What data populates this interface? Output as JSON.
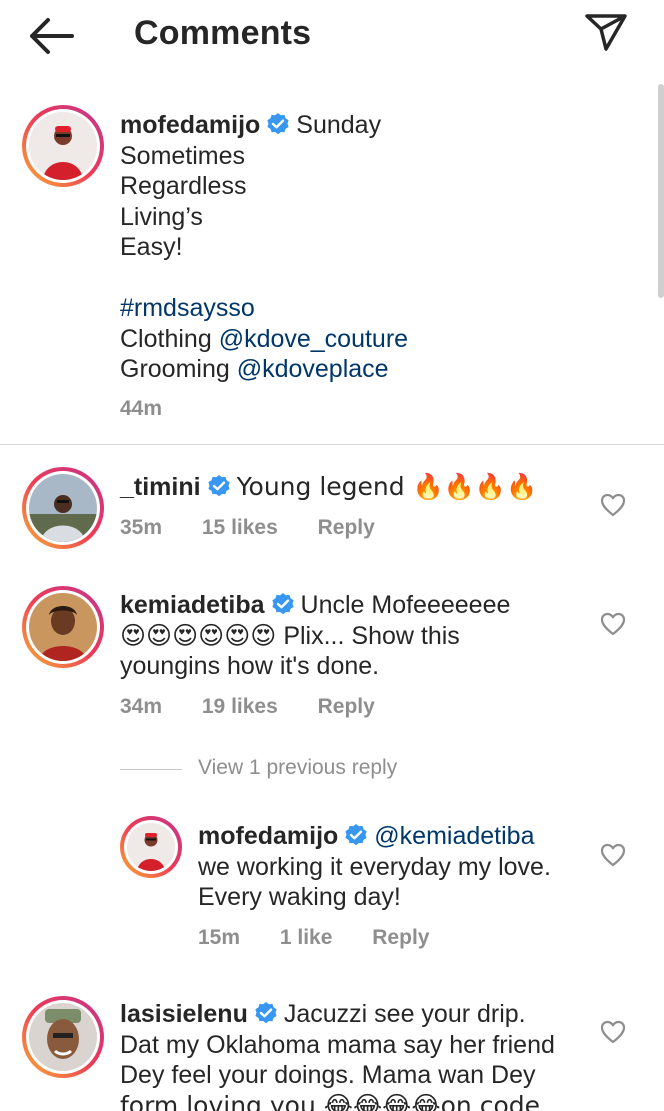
{
  "header": {
    "title": "Comments"
  },
  "caption": {
    "username": "mofedamijo",
    "lines": [
      "Sunday",
      "Sometimes",
      "Regardless",
      "Living’s",
      "Easy!"
    ],
    "hashtag": "#rmdsaysso",
    "clothing_label": "Clothing",
    "clothing_mention": "@kdove_couture",
    "grooming_label": "Grooming",
    "grooming_mention": "@kdoveplace",
    "time": "44m"
  },
  "comments": [
    {
      "username": "_timini",
      "text": "Young legend 🔥🔥🔥🔥",
      "time": "35m",
      "likes": "15 likes",
      "reply": "Reply"
    },
    {
      "username": "kemiadetiba",
      "text_line1": "Uncle Mofeeeeeee",
      "emojis": "😍😍😍😍😍😍",
      "text_line2": "Plix... Show this",
      "text_line3": "youngins how it's done.",
      "time": "34m",
      "likes": "19 likes",
      "reply": "Reply",
      "view_replies": "View 1 previous reply",
      "reply_item": {
        "username": "mofedamijo",
        "mention": "@kemiadetiba",
        "text_line1": "we working it everyday my love.",
        "text_line2": "Every waking day!",
        "time": "15m",
        "likes": "1 like",
        "reply": "Reply"
      }
    },
    {
      "username": "lasisielenu",
      "text_line1": "Jacuzzi see your drip.",
      "text_line2": "Dat my Oklahoma mama say her friend",
      "text_line3": "Dey feel your doings. Mama wan Dey",
      "text_line4": "form loving you 😂😂😂😂on code"
    }
  ],
  "colors": {
    "text": "#262626",
    "meta": "#8e8e8e",
    "link": "#00376b",
    "verified": "#3897f0"
  }
}
